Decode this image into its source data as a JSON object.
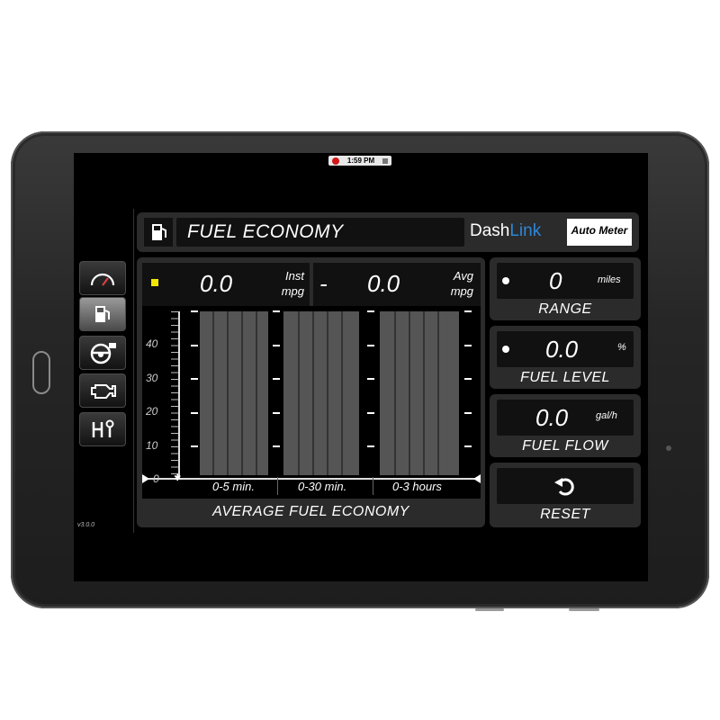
{
  "status_bar": {
    "time": "1:59 PM"
  },
  "sidebar": {
    "version": "v3.0.0",
    "items": [
      {
        "name": "gauge",
        "icon": "speedometer-icon",
        "active": false
      },
      {
        "name": "fuel",
        "icon": "fuel-pump-icon",
        "active": true
      },
      {
        "name": "steering",
        "icon": "steering-wheel-icon",
        "active": false
      },
      {
        "name": "engine",
        "icon": "check-engine-icon",
        "active": false
      },
      {
        "name": "shift",
        "icon": "shifter-icon",
        "active": false
      }
    ]
  },
  "header": {
    "icon": "fuel-pump-icon",
    "title": "FUEL ECONOMY",
    "brand_dash": "Dash",
    "brand_link": "Link",
    "logo": "Auto Meter"
  },
  "main": {
    "inst": {
      "value": "0.0",
      "unit_line1": "Inst",
      "unit_line2": "mpg"
    },
    "separator": "-",
    "avg": {
      "value": "0.0",
      "unit_line1": "Avg",
      "unit_line2": "mpg"
    },
    "footer": "AVERAGE FUEL ECONOMY",
    "y_ticks": [
      "40",
      "30",
      "20",
      "10",
      "0"
    ],
    "groups": [
      "0-5 min.",
      "0-30 min.",
      "0-3 hours"
    ]
  },
  "range": {
    "value": "0",
    "unit": "miles",
    "label": "RANGE"
  },
  "fuel_level": {
    "value": "0.0",
    "unit": "%",
    "label": "FUEL LEVEL"
  },
  "fuel_flow": {
    "value": "0.0",
    "unit": "gal/h",
    "label": "FUEL FLOW"
  },
  "reset": {
    "label": "RESET",
    "icon": "reset-arrow-icon"
  },
  "colors": {
    "accent_blue": "#2e86d8",
    "indicator_yellow": "#f2e600",
    "panel": "#2b2b2b"
  }
}
